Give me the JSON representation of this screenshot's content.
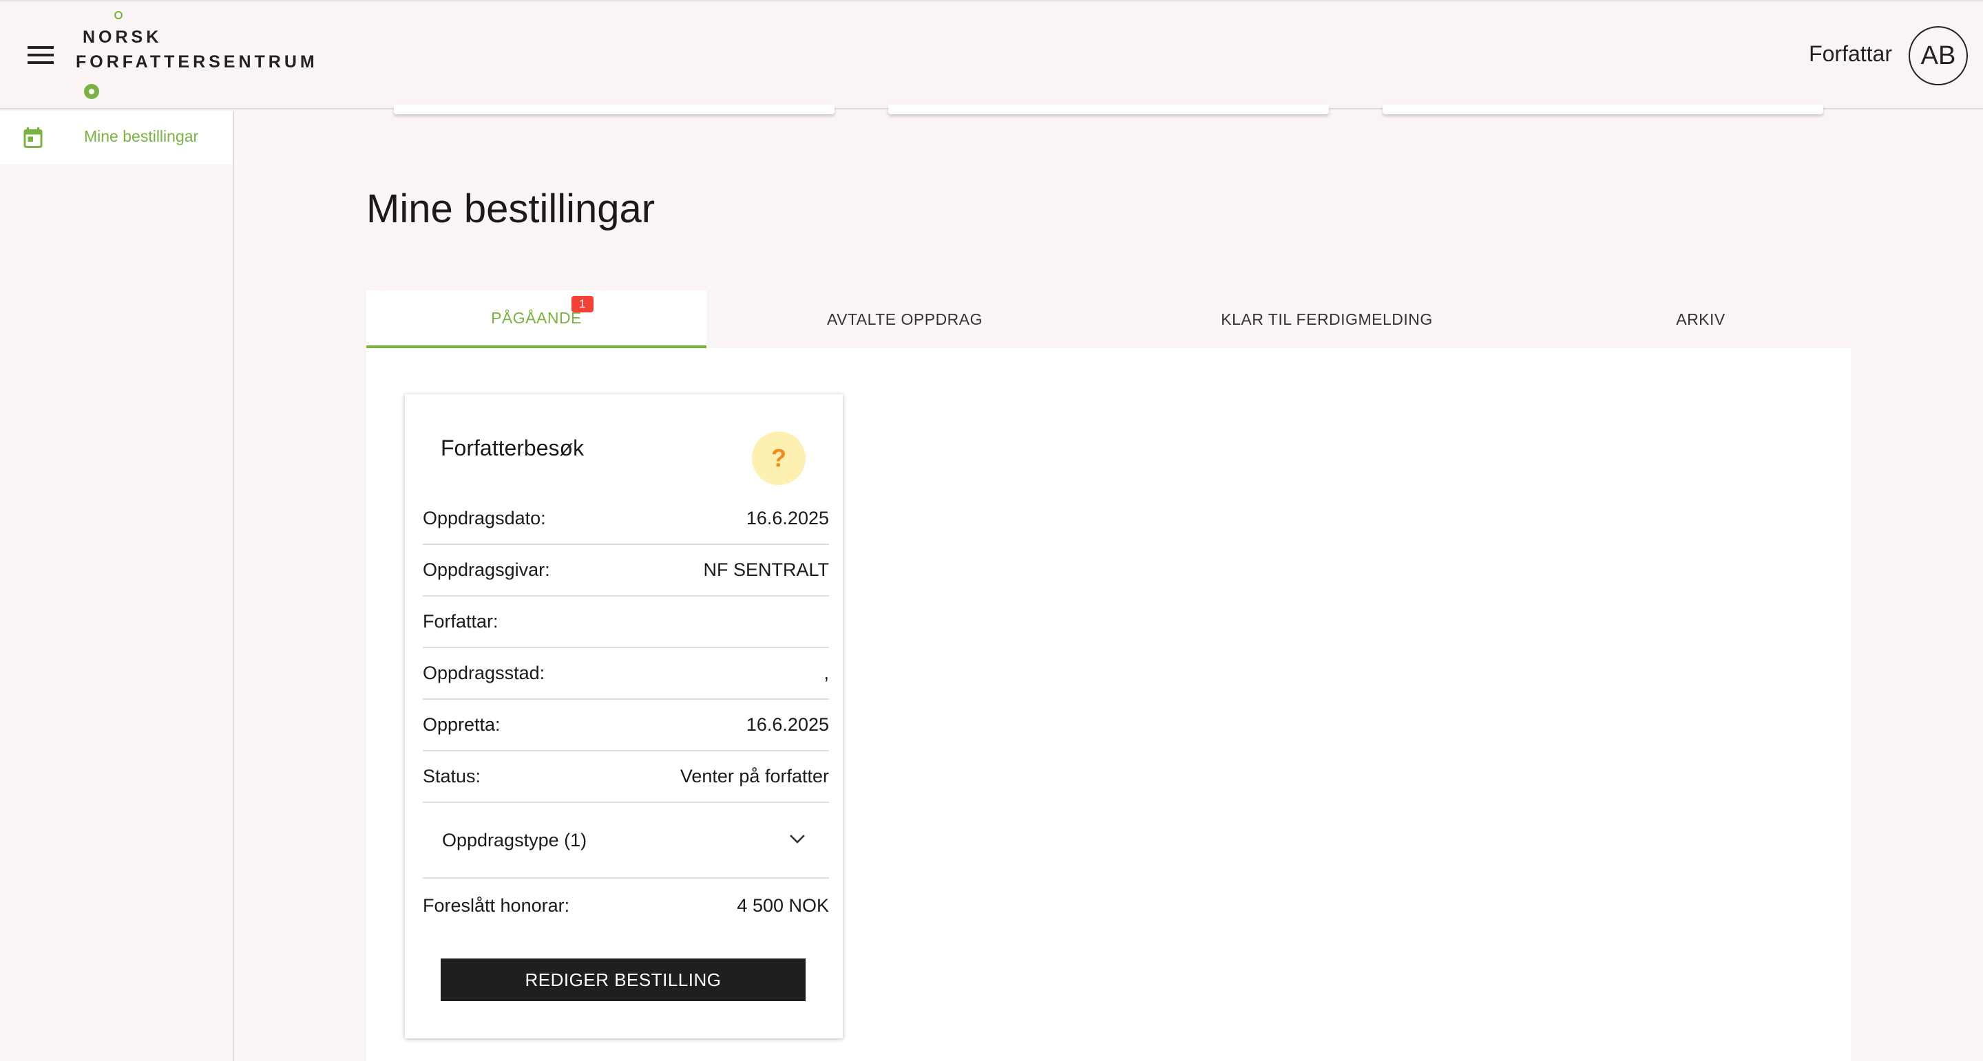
{
  "header": {
    "logo_line1": "NORSK",
    "logo_line2": "FORFATTERSENTRUM",
    "role_label": "Forfattar",
    "avatar_initials": "AB",
    "menu_icon": "hamburger-menu-icon"
  },
  "sidebar": {
    "items": [
      {
        "label": "Mine bestillingar",
        "icon": "calendar-icon",
        "active": true
      }
    ]
  },
  "main": {
    "title": "Mine bestillingar",
    "tabs": [
      {
        "label": "PÅGÅANDE",
        "active": true,
        "badge": "1"
      },
      {
        "label": "AVTALTE OPPDRAG",
        "active": false
      },
      {
        "label": "KLAR TIL FERDIGMELDING",
        "active": false
      },
      {
        "label": "ARKIV",
        "active": false
      }
    ],
    "card": {
      "title": "Forfatterbesøk",
      "status_icon": "question-mark-icon",
      "status_icon_glyph": "?",
      "rows": [
        {
          "label": "Oppdragsdato:",
          "value": "16.6.2025"
        },
        {
          "label": "Oppdragsgivar:",
          "value": "NF SENTRALT"
        },
        {
          "label": "Forfattar:",
          "value": ""
        },
        {
          "label": "Oppdragsstad:",
          "value": ","
        },
        {
          "label": "Oppretta:",
          "value": "16.6.2025"
        },
        {
          "label": "Status:",
          "value": "Venter på forfatter"
        }
      ],
      "expander_label": "Oppdragstype (1)",
      "fee_label": "Foreslått honorar:",
      "fee_value": "4 500 NOK",
      "edit_button": "REDIGER BESTILLING"
    }
  },
  "colors": {
    "accent": "#7ab342",
    "badge": "#f44336",
    "background": "#faf5f4",
    "button": "#1f1f1f",
    "status_icon_bg": "#fdf0b0",
    "status_icon_fg": "#f08a1b"
  }
}
